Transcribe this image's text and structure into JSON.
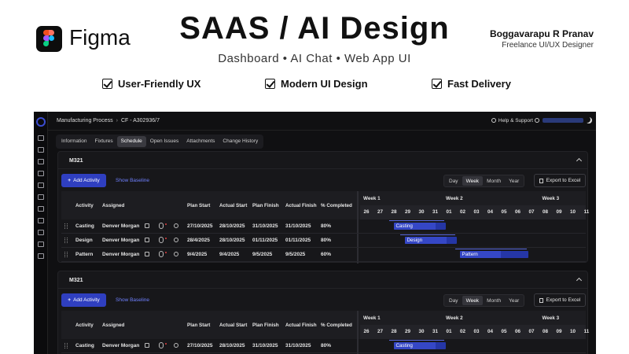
{
  "banner": {
    "brand": "Figma",
    "title": "SAAS / AI Design",
    "subtitle": "Dashboard • AI Chat • Web App UI",
    "author_name": "Boggavarapu R Pranav",
    "author_role": "Freelance UI/UX Designer",
    "features": [
      "User-Friendly UX",
      "Modern UI Design",
      "Fast Delivery"
    ]
  },
  "app": {
    "breadcrumb": [
      "Manufacturing Process",
      "CF - A302936/7"
    ],
    "help_label": "Help & Support",
    "tabs": [
      {
        "label": "Information",
        "active": false
      },
      {
        "label": "Fixtures",
        "active": false
      },
      {
        "label": "Schedule",
        "active": true
      },
      {
        "label": "Open Issues",
        "active": false
      },
      {
        "label": "Attachments",
        "active": false
      },
      {
        "label": "Change History",
        "active": false
      }
    ],
    "rail_icons": [
      "dashboard-icon",
      "chart-icon",
      "grid-icon",
      "target-icon",
      "swap-icon",
      "settings-icon",
      "trend-icon",
      "layers-icon",
      "shield-icon",
      "upload-icon",
      "refresh-icon"
    ],
    "colors": {
      "accent": "#2f3fc0",
      "link": "#6f80ff",
      "bar": "#2536a6",
      "background": "#101012"
    },
    "panels": [
      {
        "name": "M321",
        "add_label": "Add Activity",
        "baseline_label": "Show Baseline",
        "views": [
          {
            "label": "Day",
            "active": false
          },
          {
            "label": "Week",
            "active": true
          },
          {
            "label": "Month",
            "active": false
          },
          {
            "label": "Year",
            "active": false
          }
        ],
        "export_label": "Export to Excel",
        "columns": [
          "Activity",
          "Assigned",
          "Plan Start",
          "Actual Start",
          "Plan Finish",
          "Actual Finish",
          "% Completed"
        ],
        "weeks": [
          "Week 1",
          "Week 2",
          "Week 3"
        ],
        "days": [
          "26",
          "27",
          "28",
          "29",
          "30",
          "31",
          "01",
          "02",
          "03",
          "04",
          "05",
          "06",
          "07",
          "08",
          "09",
          "10",
          "11"
        ],
        "rows": [
          {
            "activity": "Casting",
            "assigned": "Denver Morgan",
            "plan_start": "27/10/2025",
            "actual_start": "28/10/2025",
            "plan_finish": "31/10/2025",
            "actual_finish": "31/10/2025",
            "completed": "80%",
            "bar_label": "Casting",
            "progress": 0.8
          },
          {
            "activity": "Design",
            "assigned": "Denver Morgan",
            "plan_start": "28/4/2025",
            "actual_start": "28/10/2025",
            "plan_finish": "01/11/2025",
            "actual_finish": "01/11/2025",
            "completed": "80%",
            "bar_label": "Design",
            "progress": 0.8
          },
          {
            "activity": "Pattern",
            "assigned": "Denver Morgan",
            "plan_start": "9/4/2025",
            "actual_start": "9/4/2025",
            "plan_finish": "9/5/2025",
            "actual_finish": "9/5/2025",
            "completed": "60%",
            "bar_label": "Pattern",
            "progress": 0.6
          }
        ]
      },
      {
        "name": "M321",
        "add_label": "Add Activity",
        "baseline_label": "Show Baseline",
        "views": [
          {
            "label": "Day",
            "active": false
          },
          {
            "label": "Week",
            "active": true
          },
          {
            "label": "Month",
            "active": false
          },
          {
            "label": "Year",
            "active": false
          }
        ],
        "export_label": "Export to Excel",
        "columns": [
          "Activity",
          "Assigned",
          "Plan Start",
          "Actual Start",
          "Plan Finish",
          "Actual Finish",
          "% Completed"
        ],
        "weeks": [
          "Week 1",
          "Week 2",
          "Week 3"
        ],
        "days": [
          "26",
          "27",
          "28",
          "29",
          "30",
          "31",
          "01",
          "02",
          "03",
          "04",
          "05",
          "06",
          "07",
          "08",
          "09",
          "10",
          "11"
        ],
        "rows": [
          {
            "activity": "Casting",
            "assigned": "Denver Morgan",
            "plan_start": "27/10/2025",
            "actual_start": "28/10/2025",
            "plan_finish": "31/10/2025",
            "actual_finish": "31/10/2025",
            "completed": "80%",
            "bar_label": "Casting",
            "progress": 0.8
          }
        ]
      }
    ]
  }
}
